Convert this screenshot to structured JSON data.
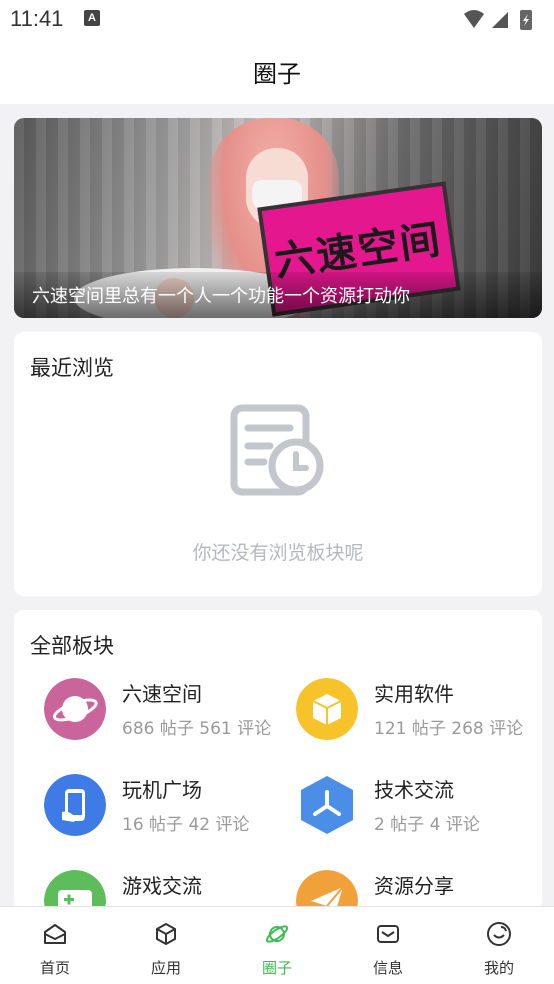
{
  "status_bar": {
    "time": "11:41",
    "notification_glyph": "A"
  },
  "header": {
    "title": "圈子"
  },
  "banner": {
    "caption": "六速空间里总有一个人一个功能一个资源打动你",
    "laptop_text": "六速空间"
  },
  "recent": {
    "title": "最近浏览",
    "empty_text": "你还没有浏览板块呢"
  },
  "boards": {
    "title": "全部板块",
    "items": [
      {
        "name": "六速空间",
        "stats": "686 帖子 561 评论",
        "icon": "planet-icon",
        "color": "#c9659a"
      },
      {
        "name": "实用软件",
        "stats": "121 帖子 268 评论",
        "icon": "box-icon",
        "color": "#f6c42a"
      },
      {
        "name": "玩机广场",
        "stats": "16 帖子 42 评论",
        "icon": "phone-hand-icon",
        "color": "#3f7be6"
      },
      {
        "name": "技术交流",
        "stats": "2 帖子 4 评论",
        "icon": "hexagon-icon",
        "color": "#4a8ee8"
      },
      {
        "name": "游戏交流",
        "stats": "",
        "icon": "gamepad-icon",
        "color": "#5dbd5a"
      },
      {
        "name": "资源分享",
        "stats": "",
        "icon": "paper-plane-icon",
        "color": "#f2a13a"
      }
    ]
  },
  "tabbar": {
    "active": "圈子",
    "tabs": [
      {
        "label": "首页",
        "icon": "home-icon"
      },
      {
        "label": "应用",
        "icon": "cube-icon"
      },
      {
        "label": "圈子",
        "icon": "planet-icon"
      },
      {
        "label": "信息",
        "icon": "mail-icon"
      },
      {
        "label": "我的",
        "icon": "smile-icon"
      }
    ]
  }
}
